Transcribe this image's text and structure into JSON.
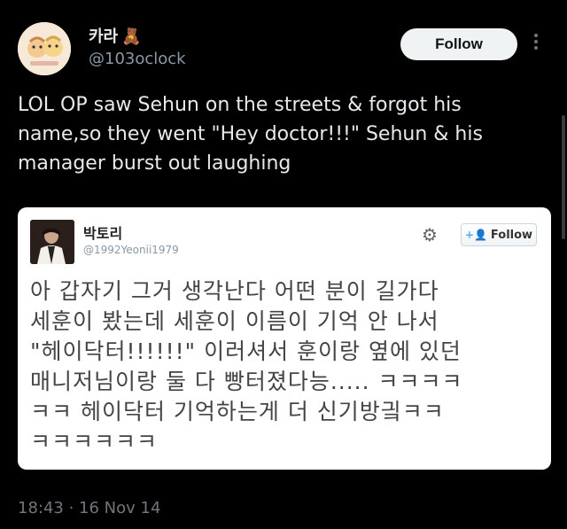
{
  "author": {
    "display_name": "카라",
    "name_emoji": "🧸",
    "handle": "@103oclock"
  },
  "follow_label": "Follow",
  "tweet_text": "LOL OP saw Sehun on the streets & forgot his name,so they went \"Hey doctor!!!\" Sehun & his manager burst out laughing",
  "embedded_tweet": {
    "display_name": "박토리",
    "handle": "@1992Yeonii1979",
    "follow_label": "Follow",
    "text": "아 갑자기 그거 생각난다 어떤 분이 길가다\n세훈이 봤는데 세훈이 이름이 기억 안 나서\n\"헤이닥터!!!!!!\" 이러셔서 훈이랑 옆에 있던\n매니저님이랑 둘 다 빵터졌다능..... ㅋㅋㅋㅋ\nㅋㅋ 헤이닥터 기억하는게 더 신기방긬ㅋㅋ\nㅋㅋㅋㅋㅋㅋ"
  },
  "timestamp": "18:43 · 16 Nov 14",
  "icons": {
    "more": "more-vertical-icon",
    "gear": "gear-icon",
    "follow_plus": "person-plus-icon"
  },
  "colors": {
    "background": "#000000",
    "text": "#e7e9ea",
    "muted": "#71767b",
    "follow_bg": "#eff3f4",
    "twitter_blue": "#55acee"
  }
}
